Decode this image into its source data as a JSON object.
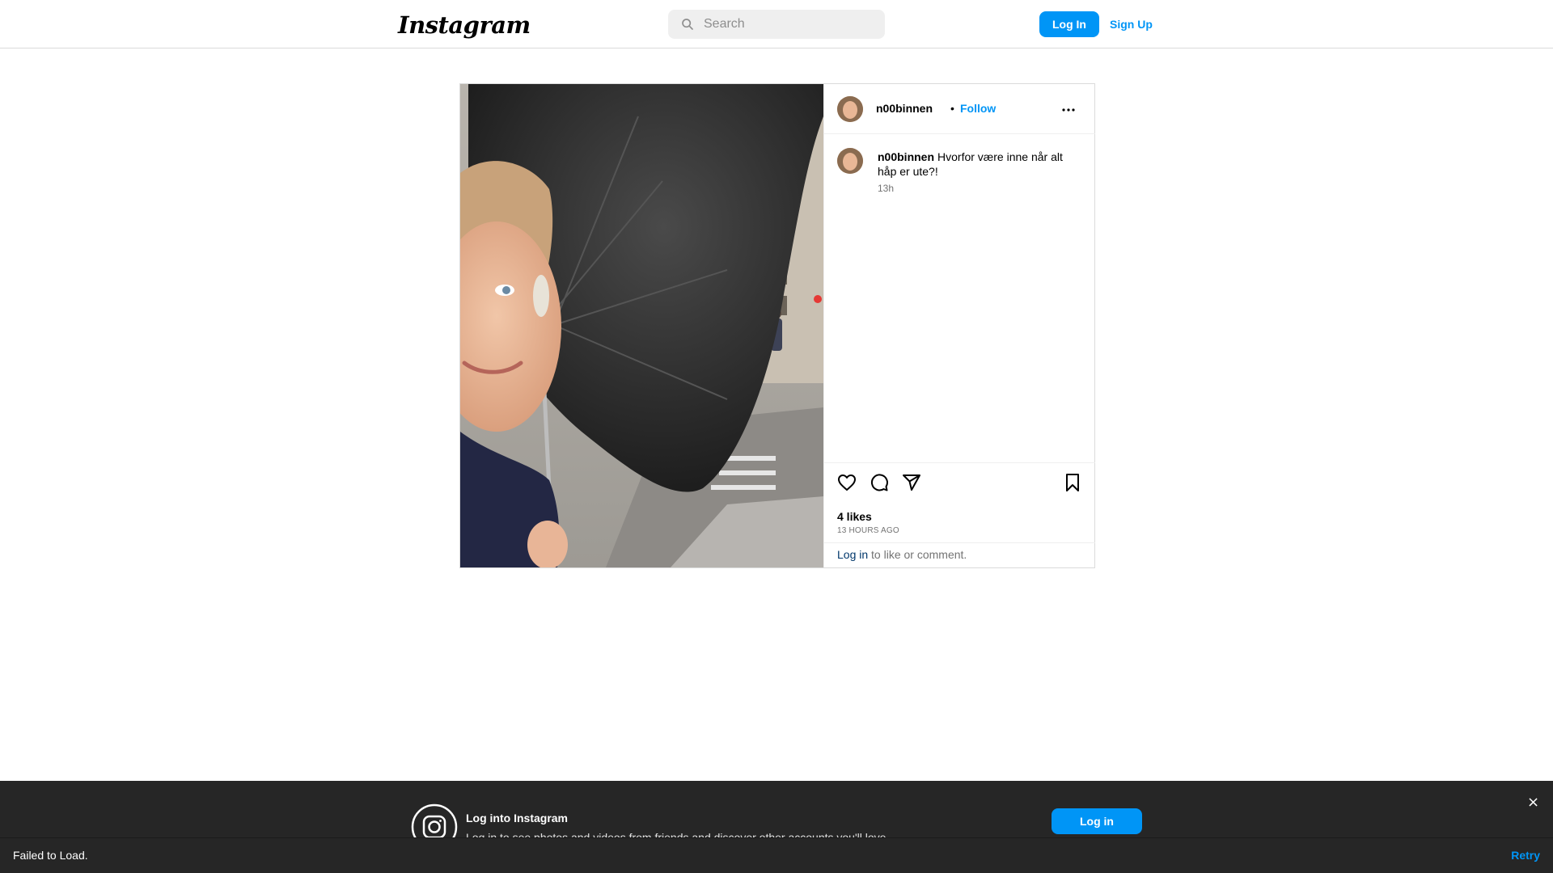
{
  "header": {
    "logo_text": "Instagram",
    "search_placeholder": "Search",
    "login_label": "Log In",
    "signup_label": "Sign Up"
  },
  "post": {
    "username": "n00binnen",
    "separator": "•",
    "follow_label": "Follow",
    "caption": "Hvorfor være inne når alt håp er ute?!",
    "caption_time": "13h",
    "likes": "4 likes",
    "posted_ago": "13 HOURS AGO",
    "login_link": "Log in",
    "login_rest": " to like or comment."
  },
  "banner": {
    "title": "Log into Instagram",
    "subtitle": "Log in to see photos and videos from friends and discover other accounts you'll love.",
    "login_label": "Log in",
    "close_label": "×"
  },
  "toast": {
    "message": "Failed to Load.",
    "retry_label": "Retry"
  },
  "colors": {
    "accent": "#0095f6",
    "banner_bg": "#262626"
  },
  "icons": [
    "search-icon",
    "more-options-icon",
    "heart-icon",
    "comment-icon",
    "share-icon",
    "bookmark-icon",
    "instagram-icon"
  ]
}
